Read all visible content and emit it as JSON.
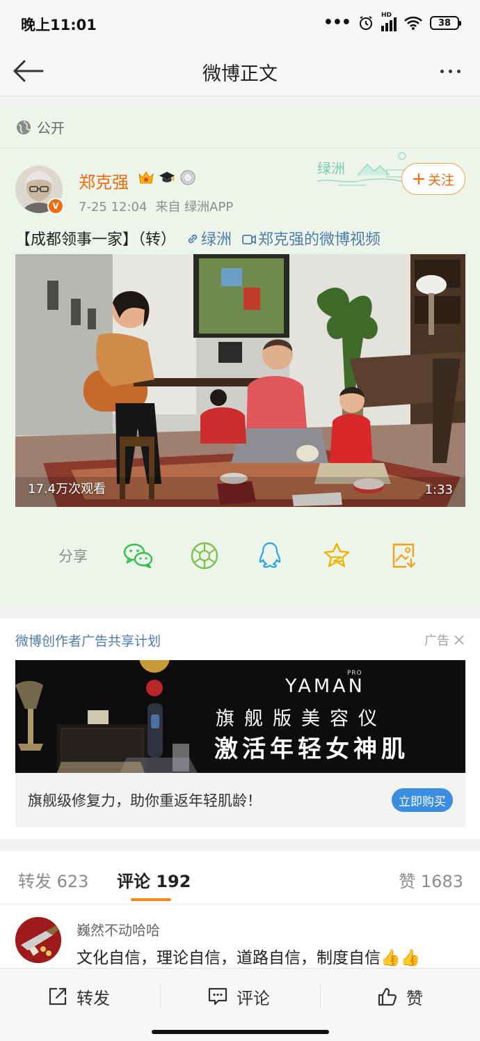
{
  "status_bar": {
    "time": "晚上11:01",
    "battery": "38",
    "hd_label": "HD",
    "icons": [
      "more-dots-icon",
      "alarm-icon",
      "signal-icon",
      "wifi-icon",
      "battery-icon"
    ]
  },
  "nav": {
    "title": "微博正文",
    "back_icon": "back-arrow-icon",
    "more_icon": "more-dots-icon"
  },
  "post": {
    "visibility": "公开",
    "username": "郑克强",
    "time": "7-25 12:04",
    "source": "来自 绿洲APP",
    "follow_label": "关注",
    "oasis_label": "绿洲",
    "text": "【成都领事一家】（转）",
    "link_oasis": "绿洲",
    "link_video": "郑克强的微博视频",
    "video": {
      "views": "17.4万次观看",
      "duration": "1:33"
    },
    "share_label": "分享",
    "share_targets": [
      "wechat-icon",
      "moments-icon",
      "qq-icon",
      "qzone-icon",
      "save-image-icon"
    ],
    "badge_icons": [
      "crown-icon",
      "graduation-cap-icon",
      "medal-icon"
    ]
  },
  "ad": {
    "title": "微博创作者广告共享计划",
    "tag": "广告",
    "brand": "YAMAN",
    "brand_sup": "PRO",
    "line1": "旗舰版美容仪",
    "line2": "激活年轻女神肌",
    "description": "旗舰级修复力，助你重返年轻肌龄！",
    "cta": "立即购买"
  },
  "tabs": {
    "repost": "转发 623",
    "comment": "评论 192",
    "like": "赞 1683"
  },
  "comment": {
    "user": "巍然不动哈哈",
    "text": "文化自信，理论自信，道路自信，制度自信👍👍"
  },
  "bottom_bar": {
    "repost": "转发",
    "comment": "评论",
    "like": "赞"
  },
  "colors": {
    "username": "#f06a0f",
    "link": "#4f7cae",
    "post_bg": "#edf5ea",
    "cta": "#3b8de0",
    "tab_underline": "#f08a1e"
  }
}
